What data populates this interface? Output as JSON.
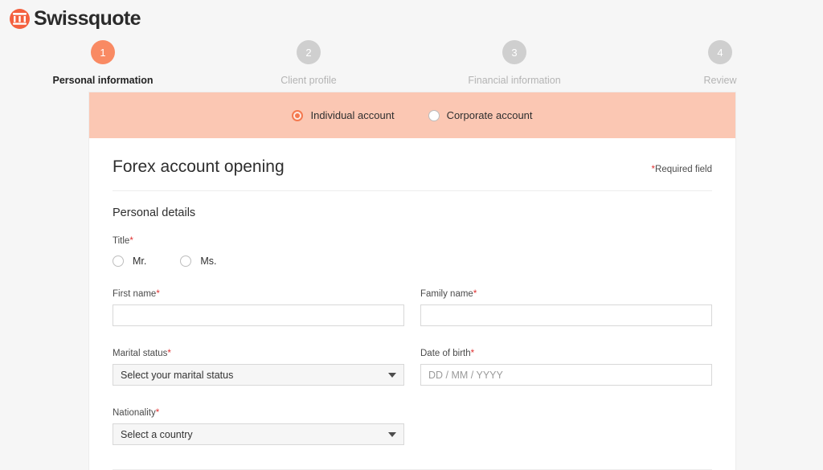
{
  "brand": {
    "name": "Swissquote",
    "logo_color": "#f4603e"
  },
  "stepper": {
    "steps": [
      {
        "number": "1",
        "label": "Personal information",
        "state": "active"
      },
      {
        "number": "2",
        "label": "Client profile",
        "state": "inactive"
      },
      {
        "number": "3",
        "label": "Financial information",
        "state": "inactive"
      },
      {
        "number": "4",
        "label": "Review",
        "state": "inactive"
      }
    ],
    "active_color": "#f98a63",
    "inactive_color": "#cfcfcf"
  },
  "account_type": {
    "banner_color": "#fbc7b3",
    "options": [
      {
        "label": "Individual account",
        "selected": true
      },
      {
        "label": "Corporate account",
        "selected": false
      }
    ]
  },
  "form": {
    "title": "Forex account opening",
    "required_note": "Required field",
    "required_marker": "*",
    "section_title": "Personal details",
    "fields": {
      "title": {
        "label": "Title",
        "options": [
          {
            "label": "Mr.",
            "selected": false
          },
          {
            "label": "Ms.",
            "selected": false
          }
        ]
      },
      "first_name": {
        "label": "First name",
        "value": "",
        "placeholder": ""
      },
      "family_name": {
        "label": "Family name",
        "value": "",
        "placeholder": ""
      },
      "marital_status": {
        "label": "Marital status",
        "value": "Select your marital status"
      },
      "date_of_birth": {
        "label": "Date of birth",
        "value": "",
        "placeholder": "DD / MM / YYYY"
      },
      "nationality": {
        "label": "Nationality",
        "value": "Select a country"
      }
    }
  }
}
